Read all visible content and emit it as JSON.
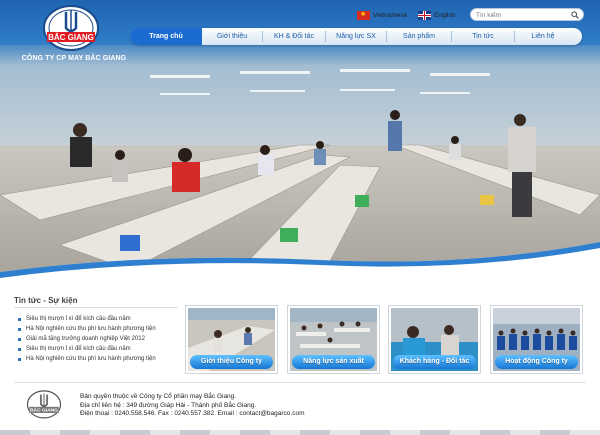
{
  "brand": {
    "logo_text": "BẮC GIANG",
    "company_name": "CÔNG TY CP MAY BẮC GIANG"
  },
  "languages": [
    {
      "label": "Vietnamese",
      "flag": "vn-flag-icon"
    },
    {
      "label": "English",
      "flag": "uk-flag-icon"
    }
  ],
  "search": {
    "placeholder": "Tìn kiếm",
    "icon": "search-icon"
  },
  "nav": {
    "items": [
      {
        "label": "Trang chủ",
        "active": true
      },
      {
        "label": "Giới thiệu"
      },
      {
        "label": "KH & Đối tác"
      },
      {
        "label": "Năng lực SX"
      },
      {
        "label": "Sản phẩm"
      },
      {
        "label": "Tin tức"
      },
      {
        "label": "Liên hệ"
      }
    ]
  },
  "news": {
    "title": "Tin tức - Sự kiện",
    "items": [
      "Siêu thị mượn ỉ xì để kích cầu đầu năm",
      "Hà Nội nghiên cứu thu phí lưu hành phương tiện",
      "Giải mã tăng trưởng doanh nghiệp Việt 2012",
      "Siêu thị mượn ỉ xì để kích cầu đầu năm",
      "Hà Nội nghiên cứu thu phí lưu hành phương tiện"
    ]
  },
  "thumbnails": [
    {
      "label": "Giới thiệu Công ty"
    },
    {
      "label": "Năng lực sản xuất"
    },
    {
      "label": "Khách hàng - Đối tác"
    },
    {
      "label": "Hoạt động Công ty"
    }
  ],
  "footer": {
    "line1": "Bản quyền thuộc về Công ty Cổ phần may Bắc Giang.",
    "line2": "Địa chỉ liên hệ : 349 đường Giáp Hải - Thành phố Bắc Giang.",
    "line3": "Điện thoại : 0240.558.546. Fax : 0240.557.382. Email : contact@bagarco.com"
  },
  "colors": {
    "primary": "#1b6bd0",
    "header": "#2a6fb8",
    "logo_red": "#e11b22"
  }
}
